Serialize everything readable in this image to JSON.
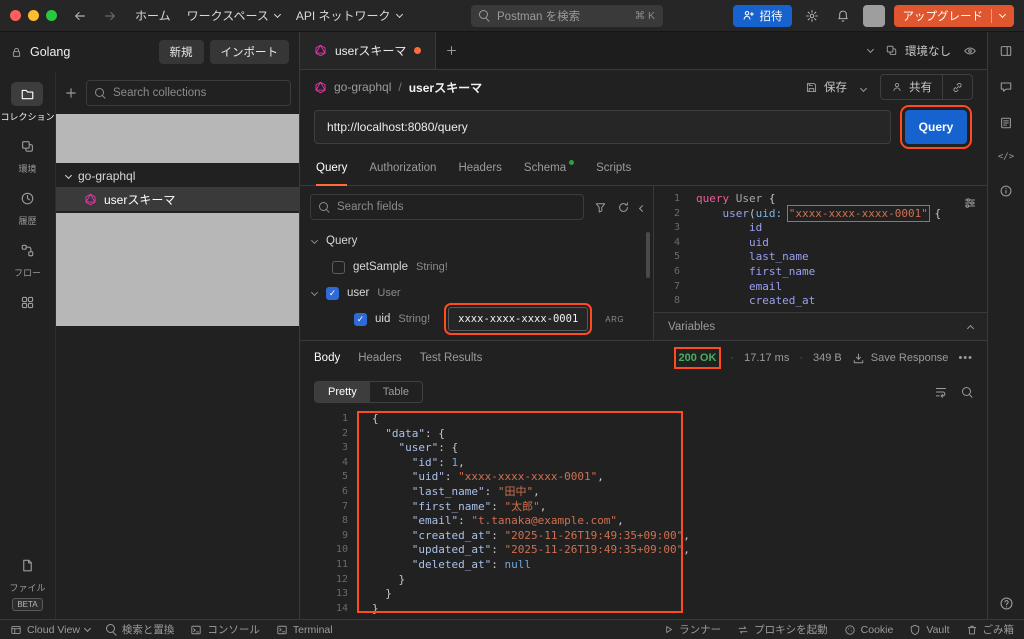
{
  "annotations": {
    "color": "#ff4b1f"
  },
  "topbar": {
    "nav_home": "ホーム",
    "nav_workspaces": "ワークスペース",
    "nav_api_network": "API ネットワーク",
    "search_placeholder": "Postman を検索",
    "search_shortcut": "⌘ K",
    "invite": "招待",
    "upgrade": "アップグレード"
  },
  "workspace": {
    "name": "Golang",
    "new_btn": "新規",
    "import_btn": "インポート"
  },
  "rail": {
    "collections": "コレクション",
    "environments": "環境",
    "history": "履歴",
    "flows": "フロー",
    "files": "ファイル",
    "beta": "BETA"
  },
  "sidebar": {
    "search_placeholder": "Search collections",
    "collection": "go-graphql",
    "request": "userスキーマ"
  },
  "tabstrip": {
    "tab": "userスキーマ",
    "environment": "環境なし"
  },
  "breadcrumb": {
    "parent": "go-graphql",
    "current": "userスキーマ"
  },
  "actions": {
    "save": "保存",
    "share": "共有"
  },
  "request": {
    "url": "http://localhost:8080/query",
    "send": "Query",
    "tabs": [
      "Query",
      "Authorization",
      "Headers",
      "Schema",
      "Scripts"
    ]
  },
  "builder": {
    "search_placeholder": "Search fields",
    "root": "Query",
    "field1": {
      "name": "getSample",
      "type": "String!"
    },
    "field2": {
      "name": "user",
      "type": "User"
    },
    "arg": {
      "name": "uid",
      "type": "String!",
      "value": "xxxx-xxxx-xxxx-0001",
      "badge": "ARG"
    }
  },
  "editor": {
    "variables_label": "Variables",
    "lines": [
      [
        [
          "k",
          "query"
        ],
        [
          "p",
          " "
        ],
        [
          "ty",
          "User"
        ],
        [
          "p",
          " {"
        ]
      ],
      [
        [
          "p",
          "    "
        ],
        [
          "f",
          "user"
        ],
        [
          "p",
          "("
        ],
        [
          "a",
          "uid:"
        ],
        [
          "p",
          " "
        ],
        [
          "s ann",
          "\"xxxx-xxxx-xxxx-0001\""
        ],
        [
          "p",
          " {"
        ]
      ],
      [
        [
          "p",
          "        "
        ],
        [
          "f",
          "id"
        ]
      ],
      [
        [
          "p",
          "        "
        ],
        [
          "f",
          "uid"
        ]
      ],
      [
        [
          "p",
          "        "
        ],
        [
          "f",
          "last_name"
        ]
      ],
      [
        [
          "p",
          "        "
        ],
        [
          "f",
          "first_name"
        ]
      ],
      [
        [
          "p",
          "        "
        ],
        [
          "f",
          "email"
        ]
      ],
      [
        [
          "p",
          "        "
        ],
        [
          "f",
          "created_at"
        ]
      ]
    ]
  },
  "response": {
    "tabs": [
      "Body",
      "Headers",
      "Test Results"
    ],
    "status": "200 OK",
    "time": "17.17 ms",
    "size": "349 B",
    "save": "Save Response",
    "more": "•••",
    "views": [
      "Pretty",
      "Table"
    ],
    "json_lines": [
      [
        [
          "p",
          "{"
        ]
      ],
      [
        [
          "p",
          "  "
        ],
        [
          "key",
          "\"data\""
        ],
        [
          "p",
          ": {"
        ]
      ],
      [
        [
          "p",
          "    "
        ],
        [
          "key",
          "\"user\""
        ],
        [
          "p",
          ": {"
        ]
      ],
      [
        [
          "p",
          "      "
        ],
        [
          "key",
          "\"id\""
        ],
        [
          "p",
          ": "
        ],
        [
          "n",
          "1"
        ],
        [
          "p",
          ","
        ]
      ],
      [
        [
          "p",
          "      "
        ],
        [
          "key",
          "\"uid\""
        ],
        [
          "p",
          ": "
        ],
        [
          "s",
          "\"xxxx-xxxx-xxxx-0001\""
        ],
        [
          "p",
          ","
        ]
      ],
      [
        [
          "p",
          "      "
        ],
        [
          "key",
          "\"last_name\""
        ],
        [
          "p",
          ": "
        ],
        [
          "s",
          "\"田中\""
        ],
        [
          "p",
          ","
        ]
      ],
      [
        [
          "p",
          "      "
        ],
        [
          "key",
          "\"first_name\""
        ],
        [
          "p",
          ": "
        ],
        [
          "s",
          "\"太郎\""
        ],
        [
          "p",
          ","
        ]
      ],
      [
        [
          "p",
          "      "
        ],
        [
          "key",
          "\"email\""
        ],
        [
          "p",
          ": "
        ],
        [
          "s",
          "\"t.tanaka@example.com\""
        ],
        [
          "p",
          ","
        ]
      ],
      [
        [
          "p",
          "      "
        ],
        [
          "key",
          "\"created_at\""
        ],
        [
          "p",
          ": "
        ],
        [
          "s",
          "\"2025-11-26T19:49:35+09:00\""
        ],
        [
          "p",
          ","
        ]
      ],
      [
        [
          "p",
          "      "
        ],
        [
          "key",
          "\"updated_at\""
        ],
        [
          "p",
          ": "
        ],
        [
          "s",
          "\"2025-11-26T19:49:35+09:00\""
        ],
        [
          "p",
          ","
        ]
      ],
      [
        [
          "p",
          "      "
        ],
        [
          "key",
          "\"deleted_at\""
        ],
        [
          "p",
          ": "
        ],
        [
          "nul",
          "null"
        ]
      ],
      [
        [
          "p",
          "    }"
        ]
      ],
      [
        [
          "p",
          "  }"
        ]
      ],
      [
        [
          "p",
          "}"
        ]
      ]
    ]
  },
  "statusbar": {
    "cloud_view": "Cloud View",
    "find_replace": "検索と置換",
    "console": "コンソール",
    "terminal": "Terminal",
    "runner": "ランナー",
    "proxy": "プロキシを起動",
    "cookies": "Cookie",
    "vault": "Vault",
    "trash": "ごみ箱"
  }
}
